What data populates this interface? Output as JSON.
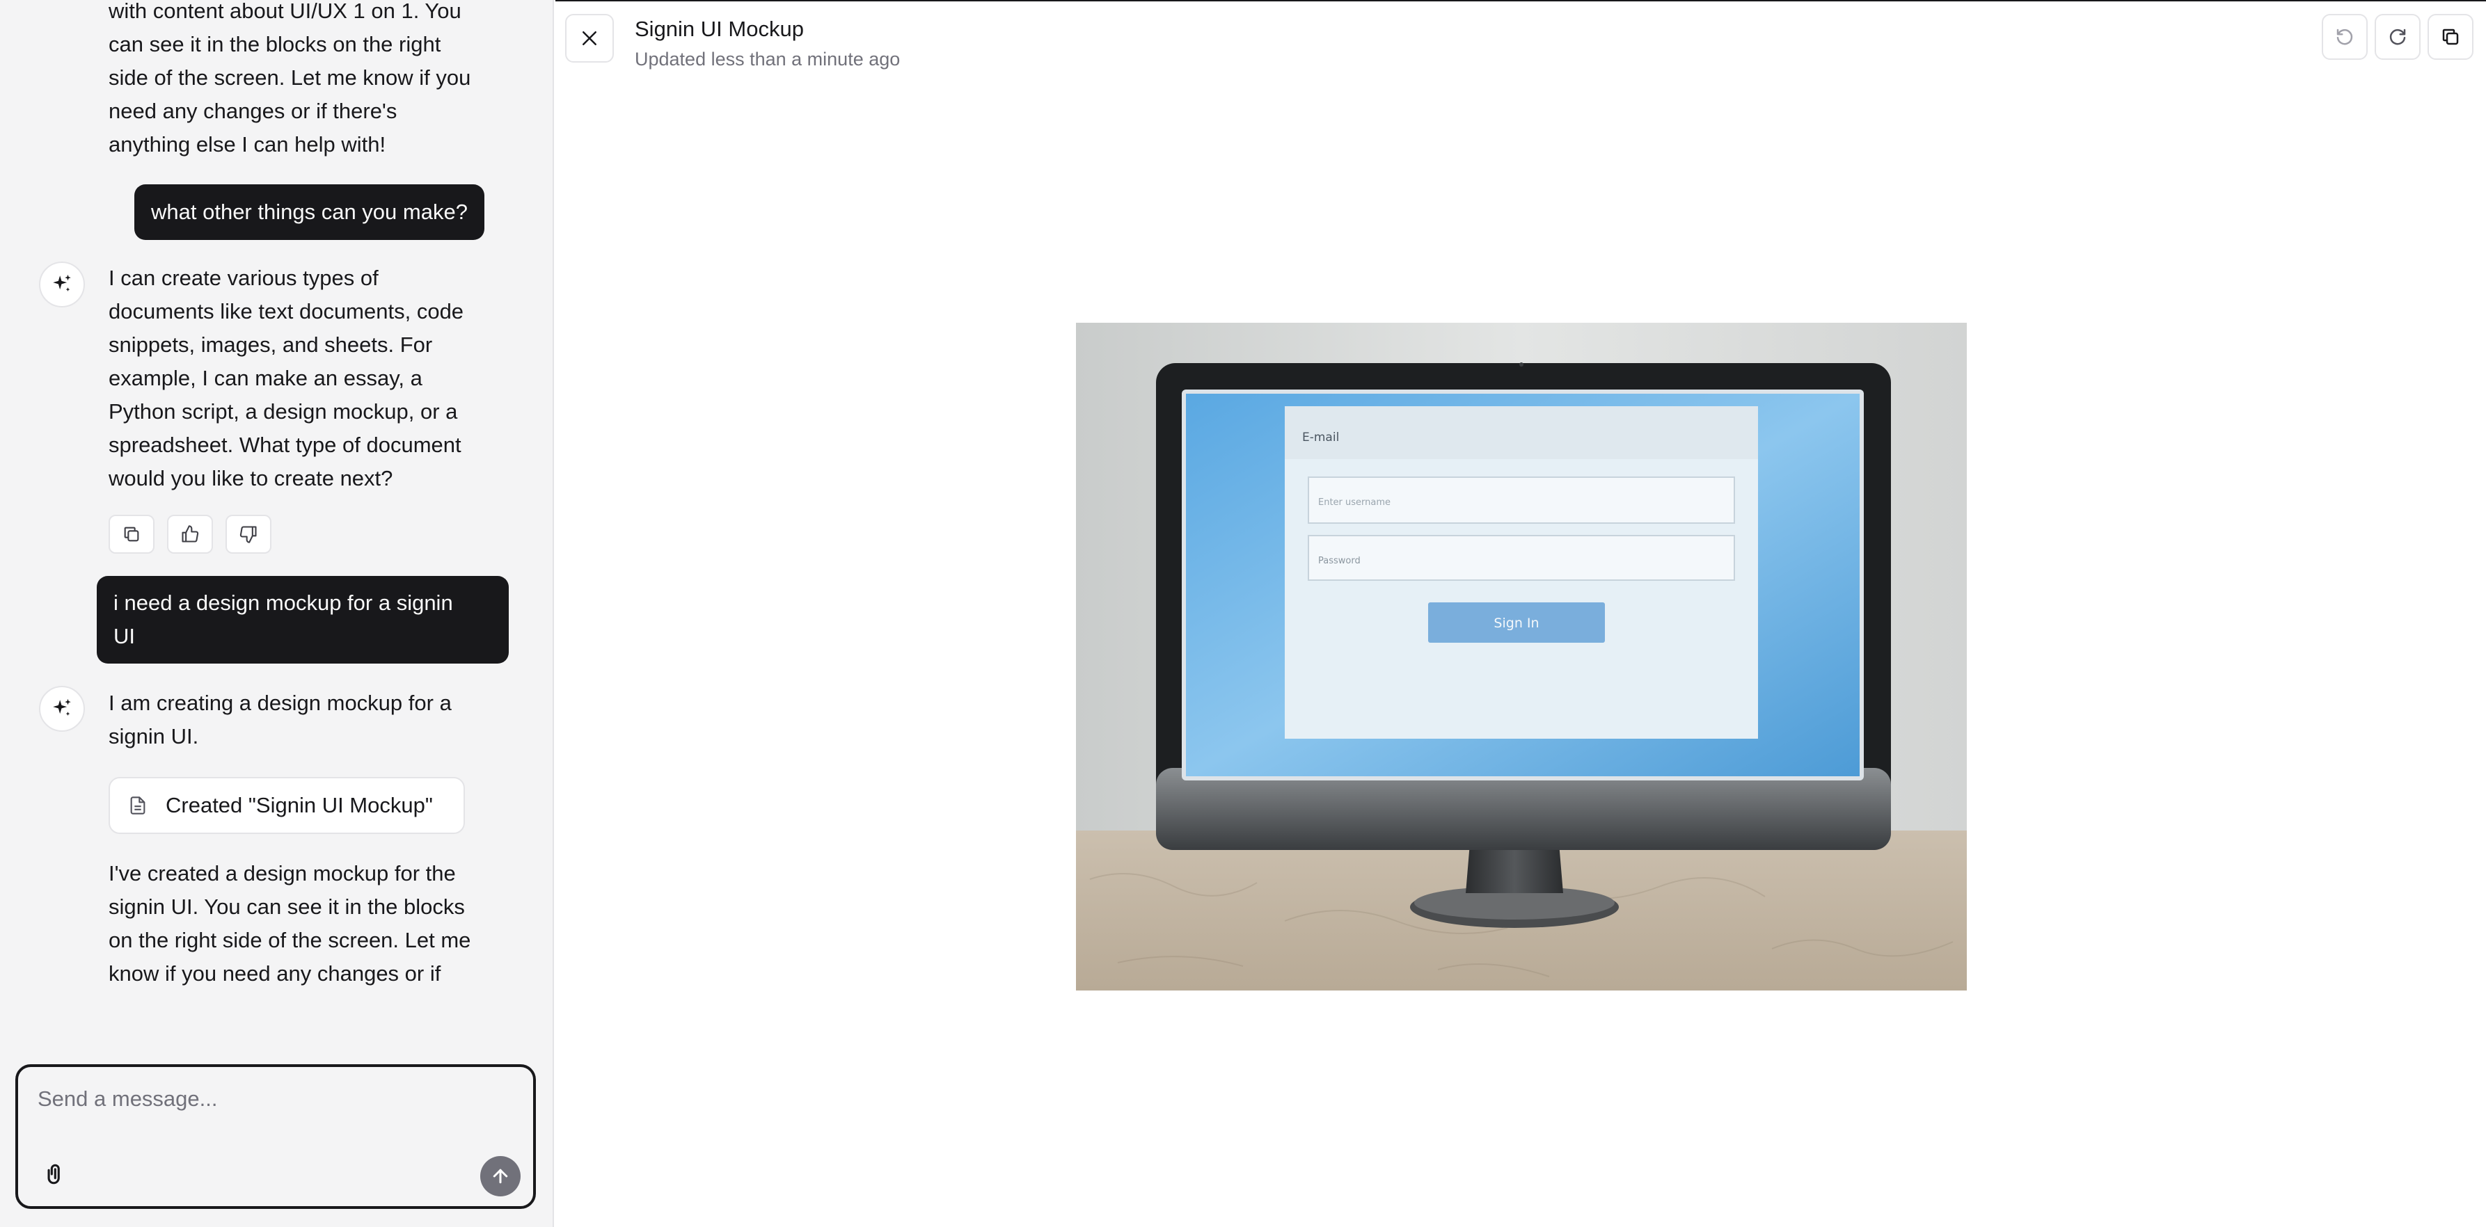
{
  "sidebar": {
    "messages": [
      {
        "role": "assistant",
        "lines": [
          "with content about UI/UX 1 on 1. You",
          "can see it in the blocks on the right",
          "side of the screen. Let me know if you",
          "need any changes or if there's",
          "anything else I can help with!"
        ]
      },
      {
        "role": "user",
        "text": "what other things can you make?"
      },
      {
        "role": "assistant",
        "lines": [
          "I can create various types of",
          "documents like text documents, code",
          "snippets, images, and sheets. For",
          "example, I can make an essay, a",
          "Python script, a design mockup, or a",
          "spreadsheet. What type of document",
          "would you like to create next?"
        ]
      },
      {
        "role": "user",
        "lines": [
          "i need a design mockup for a signin",
          "UI"
        ]
      },
      {
        "role": "assistant",
        "lines": [
          "I am creating a design mockup for a",
          "signin UI."
        ]
      },
      {
        "role": "assistant",
        "lines": [
          "I've created a design mockup for the",
          "signin UI. You can see it in the blocks",
          "on the right side of the screen. Let me",
          "know if you need any changes or if"
        ]
      }
    ],
    "doc_chip_label": "Created \"Signin UI Mockup\"",
    "composer_placeholder": "Send a message..."
  },
  "panel": {
    "title": "Signin UI Mockup",
    "updated": "Updated less than a minute ago",
    "image": {
      "email_label": "E-mail",
      "username_placeholder": "Enter username",
      "password_placeholder": "Password",
      "signin_label": "Sign In"
    }
  },
  "colors": {
    "user_bubble": "#18181b",
    "sidebar_bg": "#f4f4f5",
    "screen_blue": "#6fb4e6",
    "signin_button": "#7aaedc"
  },
  "icons": [
    "sparkle-icon",
    "copy-icon",
    "thumbs-up-icon",
    "thumbs-down-icon",
    "file-icon",
    "paperclip-icon",
    "arrow-up-icon",
    "close-icon",
    "undo-icon",
    "redo-icon",
    "copy-icon"
  ]
}
